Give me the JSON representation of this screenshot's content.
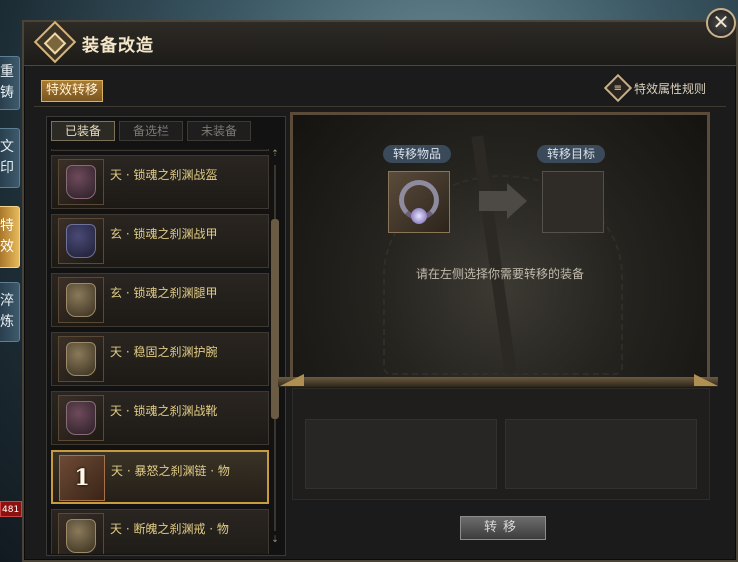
{
  "side_tabs": [
    "重铸",
    "文印",
    "特效",
    "淬炼"
  ],
  "hp_badge": "481",
  "window": {
    "title": "装备改造",
    "close_icon": "close-icon",
    "active_subtab": "特效转移",
    "rules_link": "特效属性规则"
  },
  "categories": [
    "已装备",
    "备选栏",
    "未装备"
  ],
  "active_category": "已装备",
  "items": [
    {
      "name": "天 · 锁魂之刹渊战盔",
      "icon": "helmet-icon"
    },
    {
      "name": "玄 · 锁魂之刹渊战甲",
      "icon": "armor-icon"
    },
    {
      "name": "玄 · 锁魂之刹渊腿甲",
      "icon": "legguard-icon"
    },
    {
      "name": "天 · 稳固之刹渊护腕",
      "icon": "bracer-icon"
    },
    {
      "name": "天 · 锁魂之刹渊战靴",
      "icon": "boots-icon"
    },
    {
      "name": "天 · 暴怒之刹渊链 · 物",
      "icon": "necklace-icon",
      "badge": "1",
      "selected": true
    },
    {
      "name": "天 · 断魄之刹渊戒 · 物",
      "icon": "ring-icon"
    }
  ],
  "transfer": {
    "source_label": "转移物品",
    "target_label": "转移目标",
    "hint": "请在左侧选择你需要转移的装备",
    "button": "转移"
  }
}
